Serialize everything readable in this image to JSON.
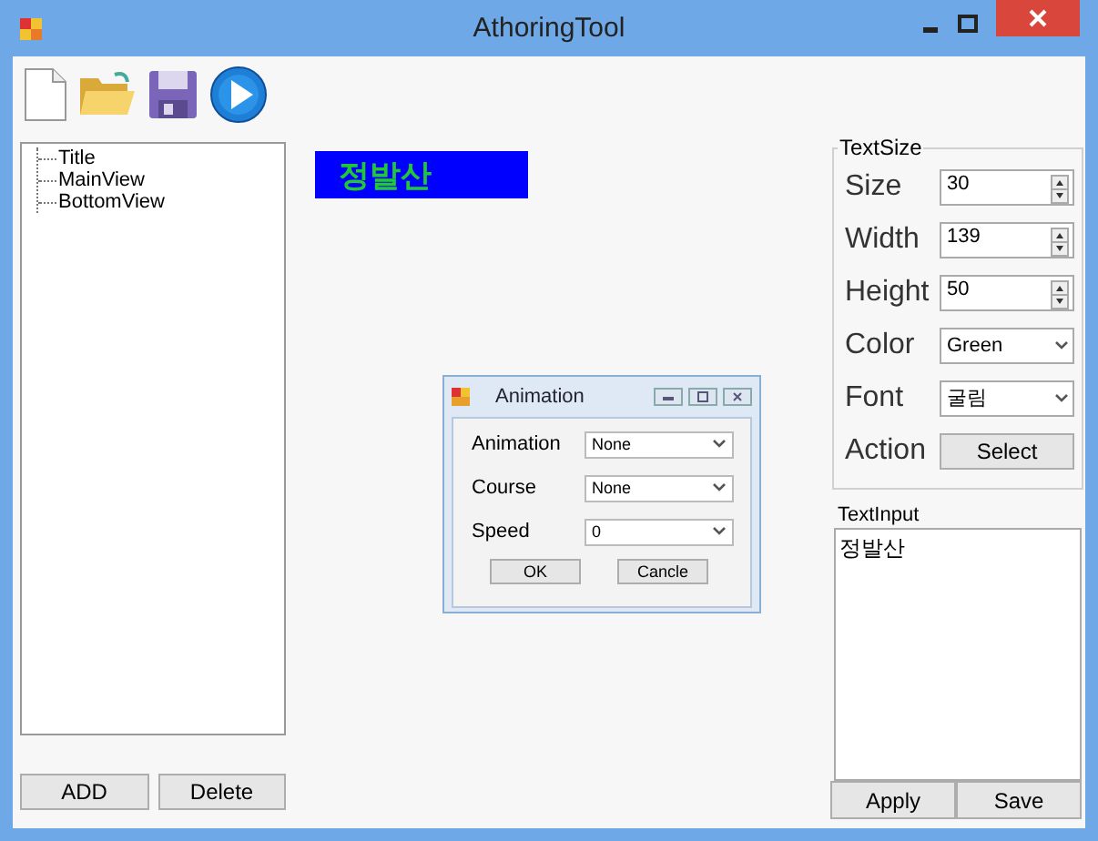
{
  "window": {
    "title": "AthoringTool"
  },
  "tree": {
    "items": [
      {
        "label": "Title"
      },
      {
        "label": "MainView"
      },
      {
        "label": "BottomView"
      }
    ]
  },
  "left_buttons": [
    "ADD",
    "Delete"
  ],
  "canvas_label": {
    "text": "정발산"
  },
  "dialog": {
    "title": "Animation",
    "fields": [
      {
        "label": "Animation",
        "value": "None",
        "kind": "dropdown"
      },
      {
        "label": "Course",
        "value": "None",
        "kind": "dropdown"
      },
      {
        "label": "Speed",
        "value": "0",
        "kind": "dropdown"
      }
    ],
    "buttons": [
      "OK",
      "Cancle"
    ]
  },
  "text_size": {
    "title": "TextSize",
    "rows": [
      {
        "label": "Size",
        "value": "30",
        "kind": "spinner"
      },
      {
        "label": "Width",
        "value": "139",
        "kind": "spinner"
      },
      {
        "label": "Height",
        "value": "50",
        "kind": "spinner"
      },
      {
        "label": "Color",
        "value": "Green",
        "kind": "dropdown"
      },
      {
        "label": "Font",
        "value": "굴림",
        "kind": "dropdown"
      },
      {
        "label": "Action",
        "value": "Select",
        "kind": "button"
      }
    ]
  },
  "text_input": {
    "label": "TextInput",
    "value": "정발산"
  },
  "right_buttons": [
    "Apply",
    "Save"
  ]
}
